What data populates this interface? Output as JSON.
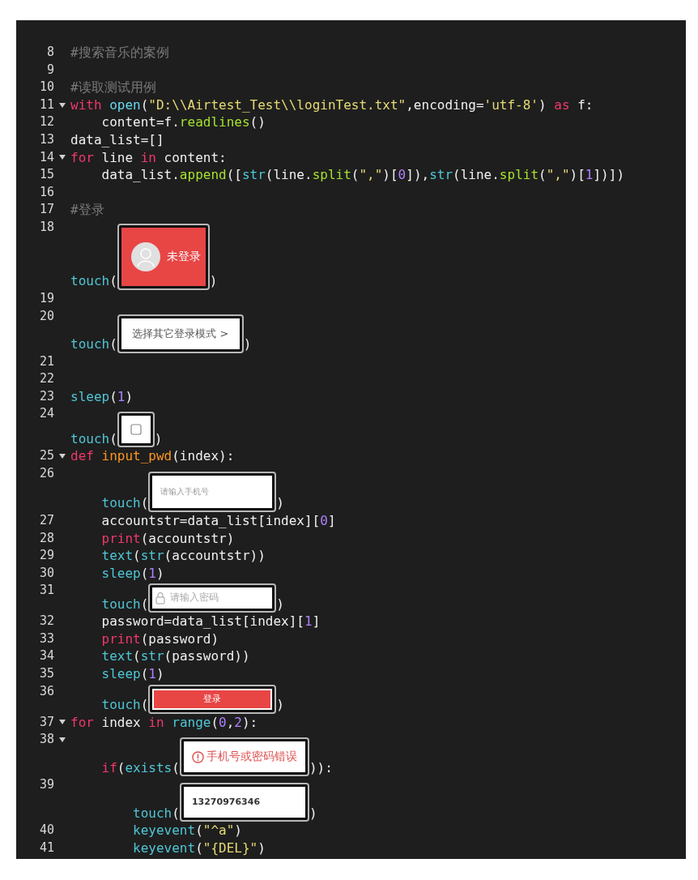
{
  "editor": {
    "lines": [
      {
        "number": "8",
        "foldable": false,
        "tokens": [
          {
            "text": "#搜索音乐的案例",
            "kind": "comment"
          }
        ]
      },
      {
        "number": "9",
        "foldable": false
      },
      {
        "number": "10",
        "foldable": false,
        "tokens": [
          {
            "text": "#读取测试用例",
            "kind": "comment"
          }
        ]
      },
      {
        "number": "11",
        "foldable": true,
        "tokens": [
          {
            "text": "with",
            "kind": "kw"
          },
          {
            "text": " open",
            "kind": "builtin"
          },
          {
            "text": "(",
            "kind": "plain"
          },
          {
            "text": "\"D:\\\\Airtest_Test\\\\loginTest.txt\"",
            "kind": "str"
          },
          {
            "text": ",encoding=",
            "kind": "plain"
          },
          {
            "text": "'utf-8'",
            "kind": "str"
          },
          {
            "text": ") ",
            "kind": "plain"
          },
          {
            "text": "as",
            "kind": "kw"
          },
          {
            "text": " f:",
            "kind": "plain"
          }
        ]
      },
      {
        "number": "12",
        "foldable": false,
        "tokens": [
          {
            "text": "    content=f.",
            "kind": "plain"
          },
          {
            "text": "readlines",
            "kind": "method"
          },
          {
            "text": "()",
            "kind": "plain"
          }
        ]
      },
      {
        "number": "13",
        "foldable": false,
        "tokens": [
          {
            "text": "data_list=[]",
            "kind": "plain"
          }
        ]
      },
      {
        "number": "14",
        "foldable": true,
        "tokens": [
          {
            "text": "for",
            "kind": "kw"
          },
          {
            "text": " line ",
            "kind": "plain"
          },
          {
            "text": "in",
            "kind": "kw"
          },
          {
            "text": " content:",
            "kind": "plain"
          }
        ]
      },
      {
        "number": "15",
        "foldable": false,
        "tokens": [
          {
            "text": "    data_list.",
            "kind": "plain"
          },
          {
            "text": "append",
            "kind": "method"
          },
          {
            "text": "([",
            "kind": "plain"
          },
          {
            "text": "str",
            "kind": "fn"
          },
          {
            "text": "(line.",
            "kind": "plain"
          },
          {
            "text": "split",
            "kind": "method"
          },
          {
            "text": "(",
            "kind": "plain"
          },
          {
            "text": "\",\"",
            "kind": "str"
          },
          {
            "text": ")[",
            "kind": "plain"
          },
          {
            "text": "0",
            "kind": "num"
          },
          {
            "text": "]),",
            "kind": "plain"
          },
          {
            "text": "str",
            "kind": "fn"
          },
          {
            "text": "(line.",
            "kind": "plain"
          },
          {
            "text": "split",
            "kind": "method"
          },
          {
            "text": "(",
            "kind": "plain"
          },
          {
            "text": "\",\"",
            "kind": "str"
          },
          {
            "text": ")[",
            "kind": "plain"
          },
          {
            "text": "1",
            "kind": "num"
          },
          {
            "text": "])])",
            "kind": "plain"
          }
        ]
      },
      {
        "number": "16",
        "foldable": false
      },
      {
        "number": "17",
        "foldable": false,
        "tokens": [
          {
            "text": "#登录",
            "kind": "comment"
          }
        ]
      },
      {
        "number": "18",
        "foldable": false,
        "tokens": [
          {
            "text": "touch",
            "kind": "fn"
          },
          {
            "text": "(",
            "kind": "plain"
          }
        ],
        "image": {
          "kind": "profile",
          "text": "未登录"
        },
        "after": ")"
      },
      {
        "number": "19",
        "foldable": false
      },
      {
        "number": "20",
        "foldable": false,
        "tokens": [
          {
            "text": "touch",
            "kind": "fn"
          },
          {
            "text": "(",
            "kind": "plain"
          }
        ],
        "image": {
          "kind": "link",
          "text": "选择其它登录模式 >"
        },
        "after": ")"
      },
      {
        "number": "21",
        "foldable": false
      },
      {
        "number": "22",
        "foldable": false
      },
      {
        "number": "23",
        "foldable": false,
        "tokens": [
          {
            "text": "sleep",
            "kind": "fn"
          },
          {
            "text": "(",
            "kind": "plain"
          },
          {
            "text": "1",
            "kind": "num"
          },
          {
            "text": ")",
            "kind": "plain"
          }
        ]
      },
      {
        "number": "24",
        "foldable": false,
        "tokens": [
          {
            "text": "touch",
            "kind": "fn"
          },
          {
            "text": "(",
            "kind": "plain"
          }
        ],
        "image": {
          "kind": "checkbox"
        },
        "after": ")"
      },
      {
        "number": "25",
        "foldable": true,
        "tokens": [
          {
            "text": "def",
            "kind": "kw"
          },
          {
            "text": " input_pwd",
            "kind": "def"
          },
          {
            "text": "(index):",
            "kind": "plain"
          }
        ]
      },
      {
        "number": "26",
        "foldable": false,
        "tokens": [
          {
            "text": "    touch",
            "kind": "fn"
          },
          {
            "text": "(",
            "kind": "plain"
          }
        ],
        "image": {
          "kind": "input",
          "text": "请输入手机号"
        },
        "after": ")"
      },
      {
        "number": "27",
        "foldable": false,
        "tokens": [
          {
            "text": "    accountstr=data_list[index][",
            "kind": "plain"
          },
          {
            "text": "0",
            "kind": "num"
          },
          {
            "text": "]",
            "kind": "plain"
          }
        ]
      },
      {
        "number": "28",
        "foldable": false,
        "tokens": [
          {
            "text": "    print",
            "kind": "kw"
          },
          {
            "text": "(accountstr)",
            "kind": "plain"
          }
        ]
      },
      {
        "number": "29",
        "foldable": false,
        "tokens": [
          {
            "text": "    text",
            "kind": "fn"
          },
          {
            "text": "(",
            "kind": "plain"
          },
          {
            "text": "str",
            "kind": "fn"
          },
          {
            "text": "(accountstr))",
            "kind": "plain"
          }
        ]
      },
      {
        "number": "30",
        "foldable": false,
        "tokens": [
          {
            "text": "    sleep",
            "kind": "fn"
          },
          {
            "text": "(",
            "kind": "plain"
          },
          {
            "text": "1",
            "kind": "num"
          },
          {
            "text": ")",
            "kind": "plain"
          }
        ]
      },
      {
        "number": "31",
        "foldable": false,
        "tokens": [
          {
            "text": "    touch",
            "kind": "fn"
          },
          {
            "text": "(",
            "kind": "plain"
          }
        ],
        "image": {
          "kind": "password",
          "text": "请输入密码"
        },
        "after": ")"
      },
      {
        "number": "32",
        "foldable": false,
        "tokens": [
          {
            "text": "    password=data_list[index][",
            "kind": "plain"
          },
          {
            "text": "1",
            "kind": "num"
          },
          {
            "text": "]",
            "kind": "plain"
          }
        ]
      },
      {
        "number": "33",
        "foldable": false,
        "tokens": [
          {
            "text": "    print",
            "kind": "kw"
          },
          {
            "text": "(password)",
            "kind": "plain"
          }
        ]
      },
      {
        "number": "34",
        "foldable": false,
        "tokens": [
          {
            "text": "    text",
            "kind": "fn"
          },
          {
            "text": "(",
            "kind": "plain"
          },
          {
            "text": "str",
            "kind": "fn"
          },
          {
            "text": "(password))",
            "kind": "plain"
          }
        ]
      },
      {
        "number": "35",
        "foldable": false,
        "tokens": [
          {
            "text": "    sleep",
            "kind": "fn"
          },
          {
            "text": "(",
            "kind": "plain"
          },
          {
            "text": "1",
            "kind": "num"
          },
          {
            "text": ")",
            "kind": "plain"
          }
        ]
      },
      {
        "number": "36",
        "foldable": false,
        "tokens": [
          {
            "text": "    touch",
            "kind": "fn"
          },
          {
            "text": "(",
            "kind": "plain"
          }
        ],
        "image": {
          "kind": "button",
          "text": "登录"
        },
        "after": ")"
      },
      {
        "number": "37",
        "foldable": true,
        "tokens": [
          {
            "text": "for",
            "kind": "kw"
          },
          {
            "text": " index ",
            "kind": "plain"
          },
          {
            "text": "in",
            "kind": "kw"
          },
          {
            "text": " range",
            "kind": "fn"
          },
          {
            "text": "(",
            "kind": "plain"
          },
          {
            "text": "0",
            "kind": "num"
          },
          {
            "text": ",",
            "kind": "plain"
          },
          {
            "text": "2",
            "kind": "num"
          },
          {
            "text": "):",
            "kind": "plain"
          }
        ]
      },
      {
        "number": "38",
        "foldable": true,
        "tokens": [
          {
            "text": "    if",
            "kind": "kw"
          },
          {
            "text": "(",
            "kind": "plain"
          },
          {
            "text": "exists",
            "kind": "fn"
          },
          {
            "text": "(",
            "kind": "plain"
          }
        ],
        "image": {
          "kind": "error",
          "text": "手机号或密码错误"
        },
        "after": ")):"
      },
      {
        "number": "39",
        "foldable": false,
        "tokens": [
          {
            "text": "        touch",
            "kind": "fn"
          },
          {
            "text": "(",
            "kind": "plain"
          }
        ],
        "image": {
          "kind": "value",
          "text": "13270976346"
        },
        "after": ")"
      },
      {
        "number": "40",
        "foldable": false,
        "tokens": [
          {
            "text": "        keyevent",
            "kind": "fn"
          },
          {
            "text": "(",
            "kind": "plain"
          },
          {
            "text": "\"^a\"",
            "kind": "str"
          },
          {
            "text": ")",
            "kind": "plain"
          }
        ]
      },
      {
        "number": "41",
        "foldable": false,
        "tokens": [
          {
            "text": "        keyevent",
            "kind": "fn"
          },
          {
            "text": "(",
            "kind": "plain"
          },
          {
            "text": "\"{DEL}\"",
            "kind": "str"
          },
          {
            "text": ")",
            "kind": "plain"
          }
        ]
      }
    ]
  }
}
